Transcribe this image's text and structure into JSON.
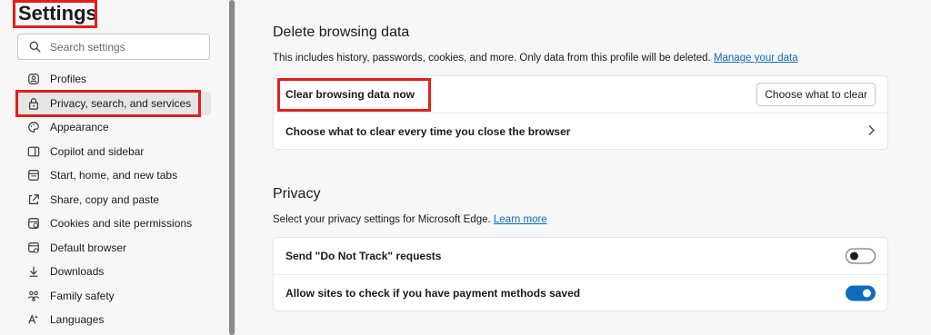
{
  "sidebar": {
    "title": "Settings",
    "search": {
      "placeholder": "Search settings",
      "value": ""
    },
    "items": [
      {
        "label": "Profiles",
        "icon": "profile-icon"
      },
      {
        "label": "Privacy, search, and services",
        "icon": "lock-icon",
        "active": true
      },
      {
        "label": "Appearance",
        "icon": "palette-icon"
      },
      {
        "label": "Copilot and sidebar",
        "icon": "sidebar-icon"
      },
      {
        "label": "Start, home, and new tabs",
        "icon": "home-tabs-icon"
      },
      {
        "label": "Share, copy and paste",
        "icon": "share-icon"
      },
      {
        "label": "Cookies and site permissions",
        "icon": "cookies-icon"
      },
      {
        "label": "Default browser",
        "icon": "browser-icon"
      },
      {
        "label": "Downloads",
        "icon": "download-icon"
      },
      {
        "label": "Family safety",
        "icon": "family-icon"
      },
      {
        "label": "Languages",
        "icon": "languages-icon"
      }
    ]
  },
  "delete_data": {
    "title": "Delete browsing data",
    "description": "This includes history, passwords, cookies, and more. Only data from this profile will be deleted.",
    "link": "Manage your data",
    "rows": {
      "clear_now": "Clear browsing data now",
      "clear_button": "Choose what to clear",
      "on_close": "Choose what to clear every time you close the browser"
    }
  },
  "privacy": {
    "title": "Privacy",
    "description": "Select your privacy settings for Microsoft Edge.",
    "link": "Learn more",
    "rows": {
      "dnt": "Send \"Do Not Track\" requests",
      "dnt_enabled": false,
      "payment": "Allow sites to check if you have payment methods saved",
      "payment_enabled": true
    }
  },
  "colors": {
    "accent": "#0f6cbd",
    "highlight_box": "#e0201b"
  }
}
